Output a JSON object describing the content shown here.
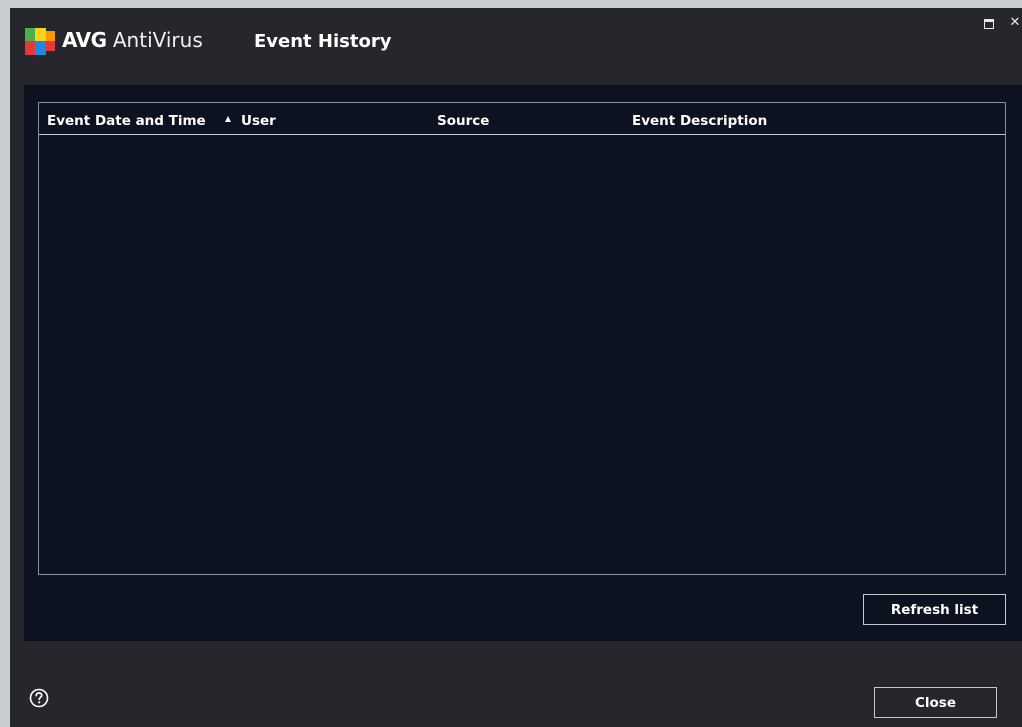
{
  "window": {
    "brand_bold": "AVG",
    "brand_light": " AntiVirus",
    "title": "Event History"
  },
  "table": {
    "columns": [
      "Event Date and Time",
      "User",
      "Source",
      "Event Description"
    ],
    "sorted_by": "Event Date and Time",
    "sort_direction": "ascending",
    "rows": []
  },
  "buttons": {
    "refresh_label": "Refresh list",
    "close_label": "Close"
  },
  "icons": {
    "logo": "avg-logo-icon",
    "help": "help-icon",
    "restore": "restore-window-icon",
    "close": "close-window-icon",
    "sort": "sort-ascending-icon"
  },
  "colors": {
    "window_bg": "#25272c",
    "panel_bg": "#0d1220",
    "border": "#8a8f99"
  }
}
